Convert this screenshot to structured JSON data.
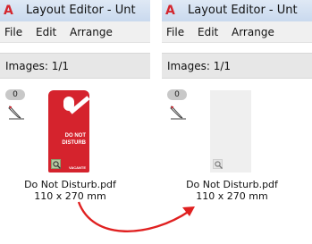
{
  "window": {
    "title": "Layout Editor - Unt"
  },
  "menu": [
    {
      "label": "File"
    },
    {
      "label": "Edit"
    },
    {
      "label": "Arrange"
    }
  ],
  "info": {
    "images_count": "Images: 1/1"
  },
  "image_item": {
    "badge": "0",
    "filename": "Do Not Disturb.pdf",
    "dimensions": "110 x 270 mm",
    "thumbnail_text_line1": "DO NOT",
    "thumbnail_text_line2": "DISTURB",
    "thumbnail_text_line3": "VACANTE"
  },
  "colors": {
    "arrow": "#e02020",
    "door_hanger": "#d5232d",
    "titlebar": "#c9d9ee"
  },
  "icons": [
    "app-logo-icon",
    "pen-edit-icon",
    "magnifier-icon",
    "curved-arrow-icon"
  ]
}
